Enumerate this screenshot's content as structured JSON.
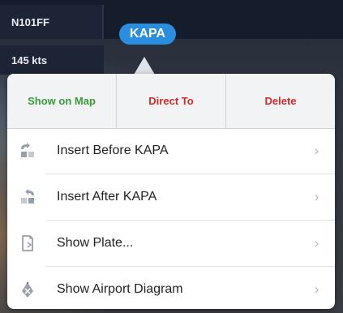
{
  "map": {
    "tail_number": "N101FF",
    "speed": "145 kts",
    "waypoint_label": "KAPA"
  },
  "popover": {
    "actions": [
      {
        "label": "Show on Map",
        "color": "#3a9a3a"
      },
      {
        "label": "Direct To",
        "color": "#d42a2a"
      },
      {
        "label": "Delete",
        "color": "#d42a2a"
      }
    ],
    "items": [
      {
        "label": "Insert Before KAPA",
        "icon": "insert-before-icon"
      },
      {
        "label": "Insert After KAPA",
        "icon": "insert-after-icon"
      },
      {
        "label": "Show Plate...",
        "icon": "plate-icon"
      },
      {
        "label": "Show Airport Diagram",
        "icon": "airport-diagram-icon"
      }
    ],
    "chevron": "›"
  },
  "colors": {
    "accent": "#2a8ee0",
    "icon_gray": "#9aa0a8"
  }
}
